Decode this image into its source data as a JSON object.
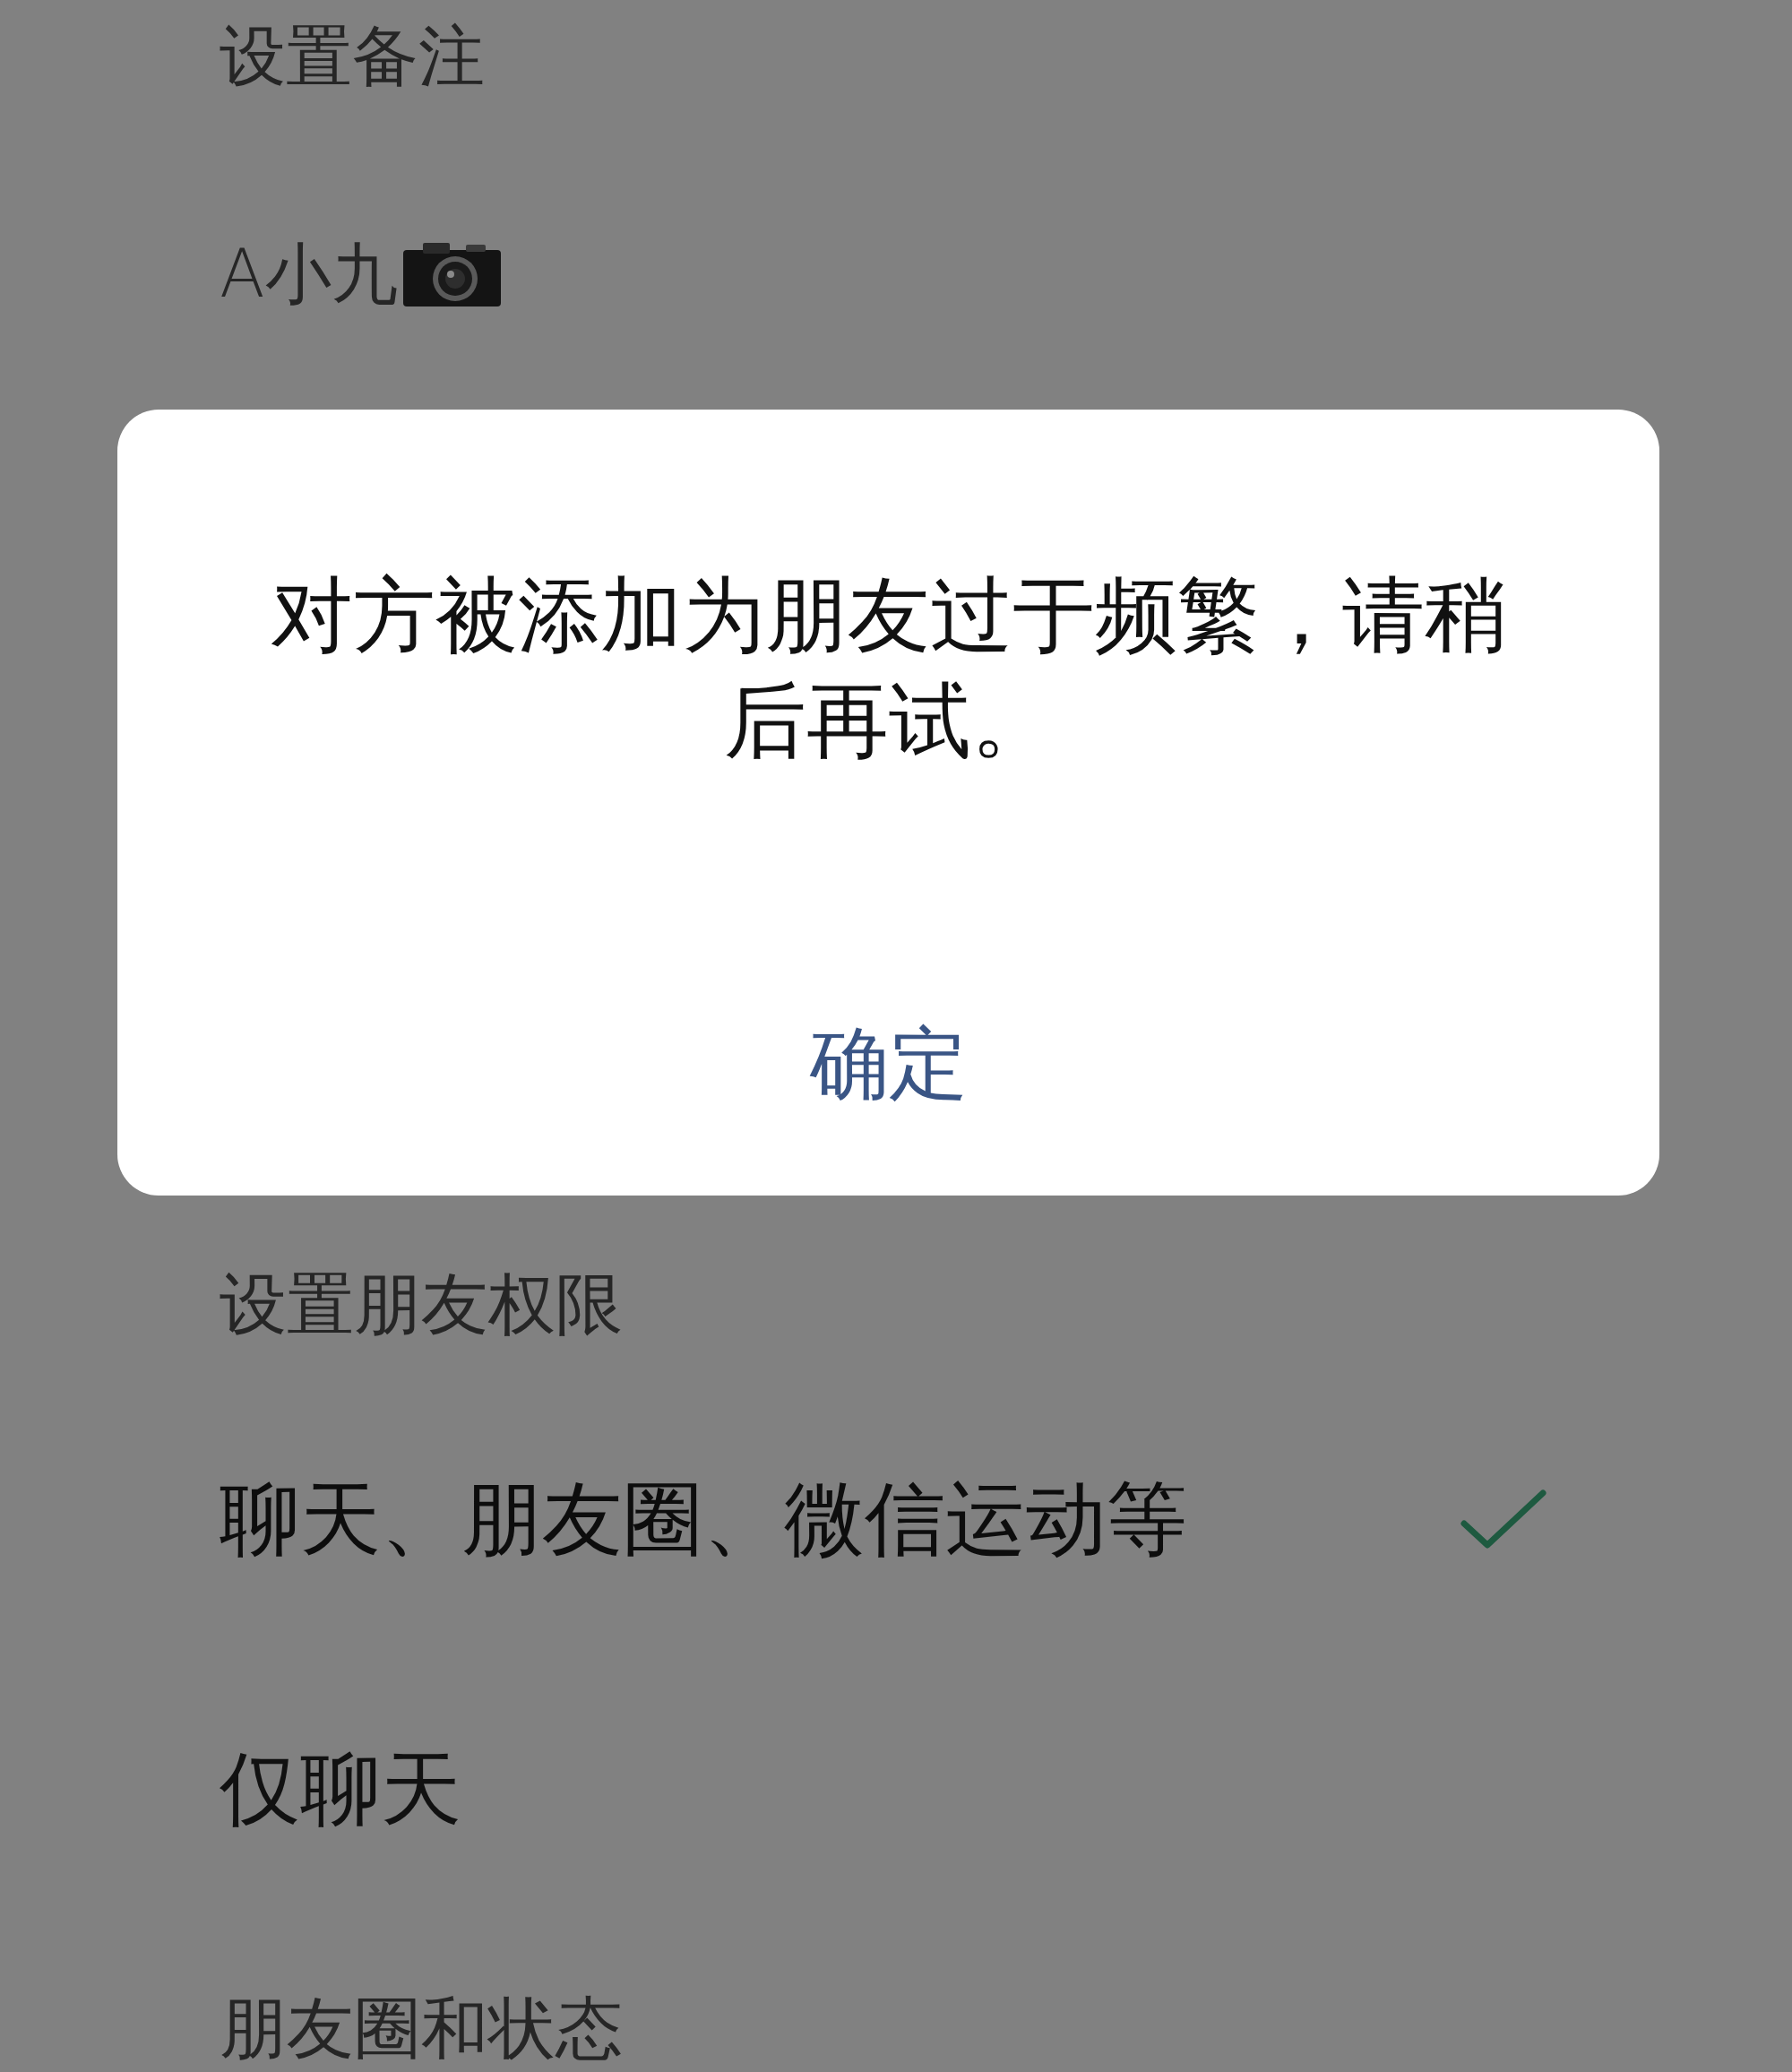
{
  "remark_section": {
    "title": "设置备注",
    "value": "A小九"
  },
  "permission_section": {
    "title": "设置朋友权限",
    "options": [
      {
        "label": "聊天、朋友圈、微信运动等",
        "selected": true
      },
      {
        "label": "仅聊天",
        "selected": false
      }
    ]
  },
  "moments_section": {
    "title": "朋友圈和状态"
  },
  "dialog": {
    "message": "对方被添加为朋友过于频繁，请稍后再试。",
    "buttons": [
      "确定"
    ]
  }
}
